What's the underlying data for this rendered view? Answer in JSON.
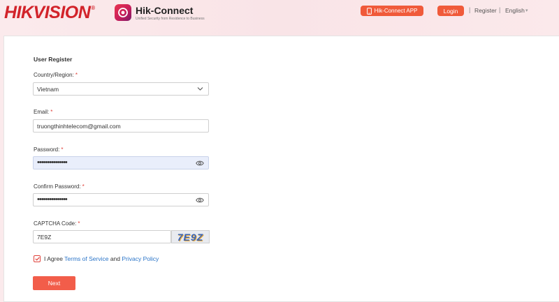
{
  "header": {
    "brand": "HIKVISION",
    "brand_mark": "®",
    "app_name": "Hik-Connect",
    "app_tagline": "Unified Security from Residence to Business",
    "app_button_label": "Hik-Connect APP",
    "login_label": "Login",
    "register_label": "Register",
    "language_label": "English",
    "separator": "|"
  },
  "form": {
    "title": "User Register",
    "required_mark": "*",
    "country": {
      "label": "Country/Region:",
      "value": "Vietnam"
    },
    "email": {
      "label": "Email:",
      "value": "truongthinhtelecom@gmail.com"
    },
    "password": {
      "label": "Password:",
      "masked": "•••••••••••••••"
    },
    "confirm_password": {
      "label": "Confirm Password:",
      "masked": "•••••••••••••••"
    },
    "captcha": {
      "label": "CAPTCHA Code:",
      "value": "7E9Z",
      "image_text": "7E9Z"
    },
    "agreement": {
      "prefix": "I Agree ",
      "terms": "Terms of Service",
      "and": " and ",
      "privacy": "Privacy Policy",
      "checked": true
    },
    "next_label": "Next"
  },
  "colors": {
    "accent": "#f05a3a",
    "brand_red": "#d2232a",
    "link": "#2a74c8"
  }
}
